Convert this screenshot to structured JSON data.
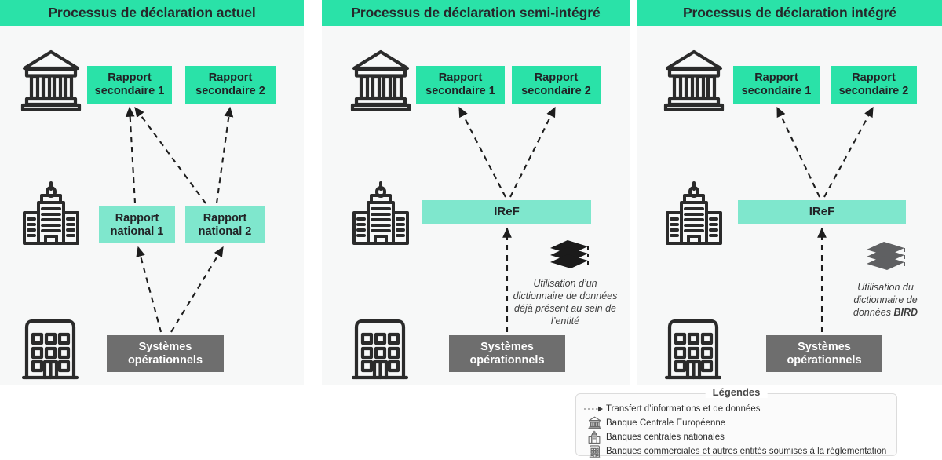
{
  "panels": [
    {
      "id": "current",
      "title": "Processus de déclaration actuel",
      "boxes": {
        "secondary1": "Rapport\nsecondaire 1",
        "secondary2": "Rapport\nsecondaire 2",
        "national1": "Rapport\nnational 1",
        "national2": "Rapport\nnational 2",
        "operational": "Systèmes\nopérationnels"
      },
      "icons": [
        "ecb-icon",
        "national-bank-icon",
        "commercial-bank-icon"
      ]
    },
    {
      "id": "semi-integrated",
      "title": "Processus de déclaration semi-intégré",
      "boxes": {
        "secondary1": "Rapport\nsecondaire 1",
        "secondary2": "Rapport\nsecondaire 2",
        "iref": "IReF",
        "operational": "Systèmes\nopérationnels"
      },
      "note": "Utilisation d’un dictionnaire de données déjà présent au sein de l’entité",
      "note_lines": [
        "Utilisation d’un",
        "dictionnaire de données",
        "déjà présent au sein de",
        "l’entité"
      ],
      "icons": [
        "ecb-icon",
        "national-bank-icon",
        "commercial-bank-icon",
        "books-icon"
      ]
    },
    {
      "id": "integrated",
      "title": "Processus de déclaration intégré",
      "boxes": {
        "secondary1": "Rapport\nsecondaire 1",
        "secondary2": "Rapport\nsecondaire 2",
        "iref": "IReF",
        "operational": "Systèmes\nopérationnels"
      },
      "note_lines": [
        "Utilisation du",
        "dictionnaire de",
        "données "
      ],
      "note_bold": "BIRD",
      "icons": [
        "ecb-icon",
        "national-bank-icon",
        "commercial-bank-icon",
        "books-icon"
      ]
    }
  ],
  "legend": {
    "title": "Légendes",
    "items": [
      {
        "icon": "dashed-arrow-icon",
        "label": "Transfert d’informations et de données"
      },
      {
        "icon": "ecb-icon",
        "label": "Banque Centrale Européenne"
      },
      {
        "icon": "national-bank-icon",
        "label": "Banques centrales nationales"
      },
      {
        "icon": "commercial-bank-icon",
        "label": "Banques commerciales et autres entités soumises à la réglementation"
      }
    ]
  },
  "colors": {
    "header_green": "#2ae2a8",
    "box_green": "#2ae2a8",
    "box_light_green": "#7fe7cd",
    "box_gray": "#6e6e6e",
    "panel_bg": "#f7f8f8",
    "ink": "#262626"
  }
}
